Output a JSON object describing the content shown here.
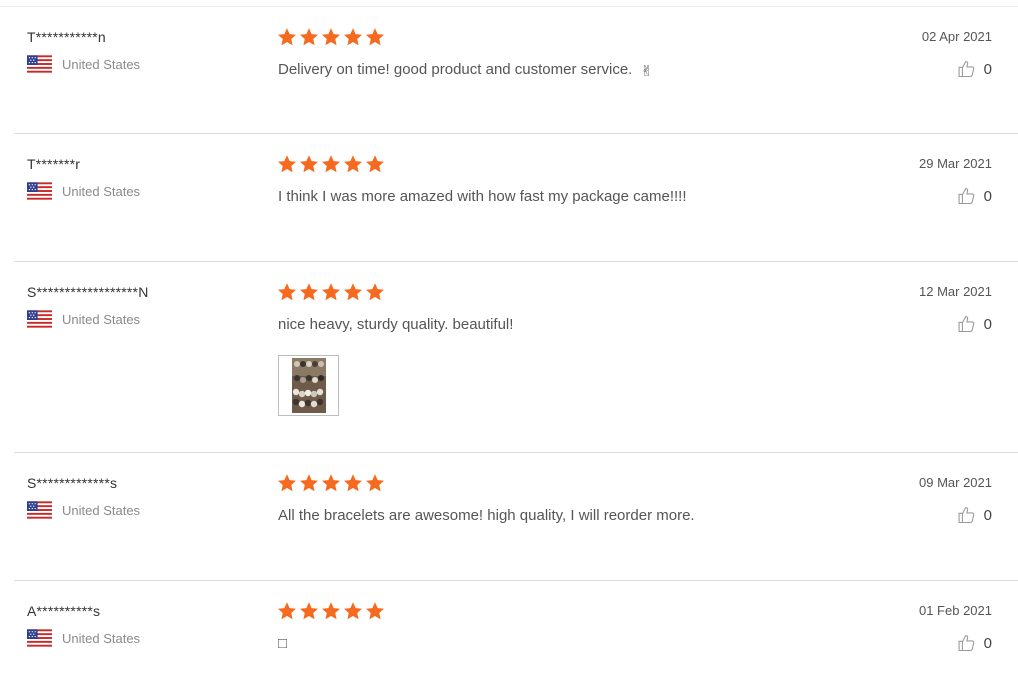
{
  "colors": {
    "star": "#f56a1f",
    "divider": "#dcdcdc",
    "muted": "#8a8a8a"
  },
  "icons": {
    "rating": "star-icon",
    "helpful": "thumbs-up-icon",
    "country": "us-flag-icon"
  },
  "reviews": [
    {
      "user": "T***********n",
      "country": "United States",
      "rating": 5,
      "text": "Delivery on time! good product and customer service.",
      "emoji": "✌",
      "date": "02 Apr 2021",
      "helpful_count": "0"
    },
    {
      "user": "T*******r",
      "country": "United States",
      "rating": 5,
      "text": "I think I was more amazed with how fast my package came!!!!",
      "date": "29 Mar 2021",
      "helpful_count": "0"
    },
    {
      "user": "S******************N",
      "country": "United States",
      "rating": 5,
      "text": "nice heavy, sturdy quality. beautiful!",
      "date": "12 Mar 2021",
      "helpful_count": "0",
      "has_photo": true
    },
    {
      "user": "S*************s",
      "country": "United States",
      "rating": 5,
      "text": "All the bracelets are awesome! high quality, I will reorder more.",
      "date": "09 Mar 2021",
      "helpful_count": "0"
    },
    {
      "user": "A**********s",
      "country": "United States",
      "rating": 5,
      "text": "□",
      "date": "01 Feb 2021",
      "helpful_count": "0"
    }
  ]
}
